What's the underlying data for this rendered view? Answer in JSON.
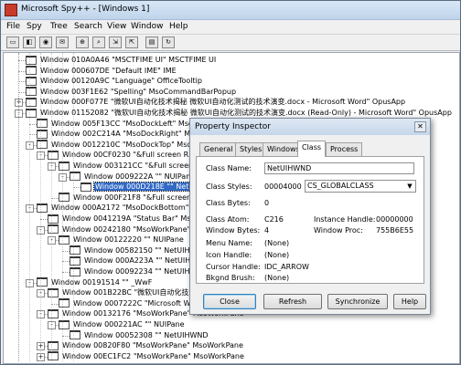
{
  "window": {
    "title": "Microsoft Spy++ - [Windows 1]"
  },
  "menu": [
    "File",
    "Spy",
    "Tree",
    "Search",
    "View",
    "Window",
    "Help"
  ],
  "tree_rows": [
    {
      "indent": 0,
      "exp": "",
      "text": "Window 010A0A46 \"MSCTFIME UI\" MSCTFIME UI"
    },
    {
      "indent": 0,
      "exp": "",
      "text": "Window 000607DE \"Default IME\" IME"
    },
    {
      "indent": 0,
      "exp": "",
      "text": "Window 00120A9C \"Language\" OfficeTooltip"
    },
    {
      "indent": 0,
      "exp": "",
      "text": "Window 003F1E62 \"Spelling\" MsoCommandBarPopup"
    },
    {
      "indent": 0,
      "exp": "+",
      "text": "Window 000F077E \"微软UI自动化技术揭秘 微软UI自动化测试的技术演变.docx - Microsoft Word\" OpusApp"
    },
    {
      "indent": 0,
      "exp": "-",
      "text": "Window 01152082 \"微软UI自动化技术揭秘 微软UI自动化测试的技术演变.docx (Read-Only) - Microsoft Word\" OpusApp"
    },
    {
      "indent": 1,
      "exp": "",
      "text": "Window 005F13CC \"MsoDockLeft\" MsoCommandBarDock"
    },
    {
      "indent": 1,
      "exp": "",
      "text": "Window 002C214A \"MsoDockRight\" MsoCommandBarDock"
    },
    {
      "indent": 1,
      "exp": "-",
      "text": "Window 0012210C \"MsoDockTop\" MsoCommandBarDock"
    },
    {
      "indent": 2,
      "exp": "-",
      "text": "Window 00CF0230 \"&Full screen Ribbon\""
    },
    {
      "indent": 3,
      "exp": "-",
      "text": "Window 003121CC \"&Full screen Ribbon\""
    },
    {
      "indent": 4,
      "exp": "-",
      "text": "Window 0009222A \"\" NUIPane"
    },
    {
      "indent": 5,
      "exp": "",
      "text": "Window 000D218E \"\" NetUIHWND",
      "selected": true
    },
    {
      "indent": 3,
      "exp": "",
      "text": "Window 000F21F8 \"&Full screen Ribbon\""
    },
    {
      "indent": 1,
      "exp": "-",
      "text": "Window 000A2172 \"MsoDockBottom\""
    },
    {
      "indent": 2,
      "exp": "",
      "text": "Window 0041219A \"Status Bar\" MsoCommandBar"
    },
    {
      "indent": 2,
      "exp": "-",
      "text": "Window 00242180 \"MsoWorkPane\" MsoWorkPane"
    },
    {
      "indent": 3,
      "exp": "-",
      "text": "Window 00122220 \"\" NUIPane"
    },
    {
      "indent": 4,
      "exp": "",
      "text": "Window 00582150 \"\" NetUIHWND"
    },
    {
      "indent": 4,
      "exp": "",
      "text": "Window 000A223A \"\" NetUIHWND"
    },
    {
      "indent": 4,
      "exp": "",
      "text": "Window 00092234 \"\" NetUIHWND"
    },
    {
      "indent": 1,
      "exp": "-",
      "text": "Window 00191514 \"\" _WwF"
    },
    {
      "indent": 2,
      "exp": "-",
      "text": "Window 001B22BC \"微软UI自动化技术揭秘\""
    },
    {
      "indent": 3,
      "exp": "",
      "text": "Window 0007222C \"Microsoft Word\""
    },
    {
      "indent": 2,
      "exp": "-",
      "text": "Window 00132176 \"MsoWorkPane\" MsoWorkPane"
    },
    {
      "indent": 3,
      "exp": "-",
      "text": "Window 000221AC \"\" NUIPane"
    },
    {
      "indent": 4,
      "exp": "",
      "text": "Window 00052308 \"\" NetUIHWND"
    },
    {
      "indent": 2,
      "exp": "+",
      "text": "Window 00820F80 \"MsoWorkPane\" MsoWorkPane"
    },
    {
      "indent": 2,
      "exp": "+",
      "text": "Window 00EC1FC2 \"MsoWorkPane\" MsoWorkPane"
    }
  ],
  "dialog": {
    "title": "Property Inspector",
    "close_glyph": "✕",
    "tabs": [
      "General",
      "Styles",
      "Windows",
      "Class",
      "Process"
    ],
    "active_tab": "Class",
    "class_name_label": "Class Name:",
    "class_name_value": "NetUIHWND",
    "class_styles_label": "Class Styles:",
    "class_styles_value": "00004000",
    "class_styles_combo": "CS_GLOBALCLASS",
    "class_bytes_label": "Class Bytes:",
    "class_bytes_value": "0",
    "class_atom_label": "Class Atom:",
    "class_atom_value": "C216",
    "instance_handle_label": "Instance Handle:",
    "instance_handle_value": "00000000",
    "window_bytes_label": "Window Bytes:",
    "window_bytes_value": "4",
    "window_proc_label": "Window Proc:",
    "window_proc_value": "755B6E55",
    "menu_name_label": "Menu Name:",
    "menu_name_value": "(None)",
    "icon_handle_label": "Icon Handle:",
    "icon_handle_value": "(None)",
    "cursor_handle_label": "Cursor Handle:",
    "cursor_handle_value": "IDC_ARROW",
    "bkgnd_brush_label": "Bkgnd Brush:",
    "bkgnd_brush_value": "(None)",
    "buttons": [
      "Close",
      "Refresh",
      "Synchronize",
      "Help"
    ]
  }
}
